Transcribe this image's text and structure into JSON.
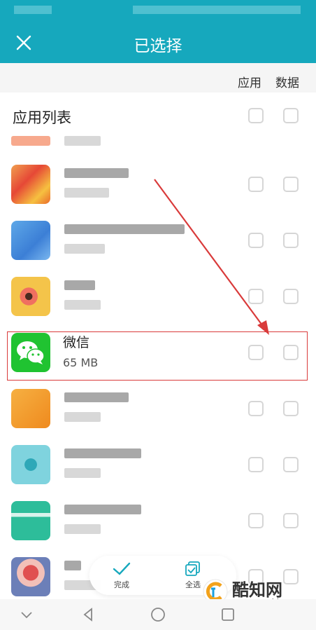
{
  "statusbar": {},
  "appbar": {
    "title": "已选择"
  },
  "columns": {
    "app_label": "应用",
    "data_label": "数据"
  },
  "list": {
    "section_title": "应用列表",
    "apps": [
      {
        "name": "",
        "size": "",
        "icon": "blurred-app-icon",
        "blurred": true
      },
      {
        "name": "",
        "size": "",
        "icon": "blurred-app-icon",
        "blurred": true
      },
      {
        "name": "",
        "size": "",
        "icon": "blurred-app-icon",
        "blurred": true
      },
      {
        "name": "微信",
        "size": "65 MB",
        "icon": "wechat-icon",
        "blurred": false
      },
      {
        "name": "",
        "size": "",
        "icon": "blurred-app-icon",
        "blurred": true
      },
      {
        "name": "",
        "size": "",
        "icon": "blurred-app-icon",
        "blurred": true
      },
      {
        "name": "",
        "size": "",
        "icon": "blurred-app-icon",
        "blurred": true
      },
      {
        "name": "",
        "size": "",
        "icon": "blurred-app-icon",
        "blurred": true
      }
    ]
  },
  "bottom_actions": {
    "done_label": "完成",
    "select_all_label": "全选"
  },
  "watermark": {
    "brand": "酷知网",
    "url": "www.coozhi.com"
  },
  "colors": {
    "accent": "#16a8bd",
    "wechat_green": "#20c331",
    "annotation_red": "#d93a3a"
  }
}
